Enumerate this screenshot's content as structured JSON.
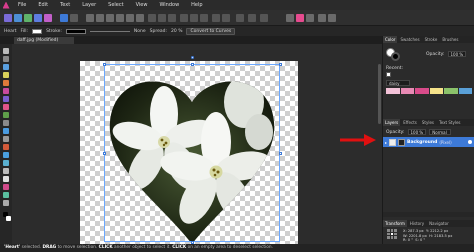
{
  "menubar": {
    "items": [
      "File",
      "Edit",
      "Text",
      "Layer",
      "Select",
      "View",
      "Window",
      "Help"
    ]
  },
  "contextbar": {
    "heart_label": "Heart",
    "fill_label": "Fill:",
    "stroke_label": "Stroke:",
    "stroke_value": "None",
    "spread_label": "Spread:",
    "spread_value": "20 %",
    "convert_label": "Convert to Curves"
  },
  "document": {
    "tab_label": "daff.jpg (Modified) (22.4%)"
  },
  "right_panel": {
    "top_tabs": [
      "Color",
      "Swatches",
      "Stroke",
      "Brushes"
    ],
    "opacity_label": "Opacity:",
    "opacity_value": "100 %",
    "recent_label": "Recent:",
    "palette_value": "daisy",
    "layers_tabs": [
      "Layers",
      "Effects",
      "Styles",
      "Text Styles"
    ],
    "layer_opacity_value": "100 %",
    "blend_mode_value": "Normal",
    "layer_name": "Background",
    "layer_type": "(Pixel)",
    "transform_tabs": [
      "Transform",
      "History",
      "Navigator"
    ],
    "x_label": "X:",
    "x_value": "287.3 px",
    "y_label": "Y:",
    "y_value": "2212.2 px",
    "w_label": "W:",
    "w_value": "2201.8 px",
    "h_label": "H:",
    "h_value": "2183.5 px",
    "r_label": "R:",
    "r_value": "0 °",
    "s_label": "S:",
    "s_value": "0 °"
  },
  "statusbar": {
    "text_1": "'Heart'",
    "text_2": " selected. ",
    "text_3": "DRAG",
    "text_4": " to move selection. ",
    "text_5": "CLICK",
    "text_6": " another object to select it. ",
    "text_7": "CLICK",
    "text_8": " on an empty area to deselect selection."
  },
  "colors": {
    "accent": "#3d7ad8",
    "arrow": "#e01010",
    "app_bg": "#1e1e1e"
  }
}
